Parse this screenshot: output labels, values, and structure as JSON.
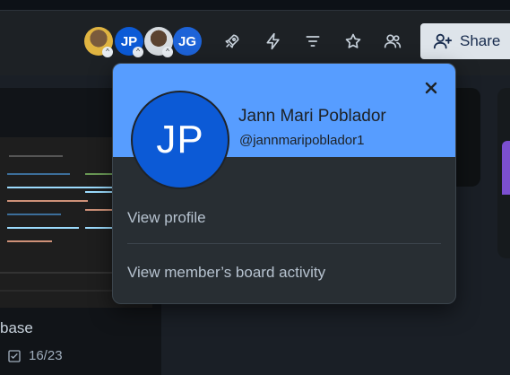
{
  "header": {
    "members": [
      {
        "initials": "",
        "type": "photo"
      },
      {
        "initials": "JP",
        "type": "initials"
      },
      {
        "initials": "",
        "type": "photo"
      },
      {
        "initials": "JG",
        "type": "initials"
      }
    ],
    "icons": [
      "rocket-icon",
      "lightning-icon",
      "filter-icon",
      "star-icon",
      "people-icon"
    ],
    "share_label": "Share"
  },
  "card": {
    "title": "base",
    "checklist": "16/23"
  },
  "popover": {
    "initials": "JP",
    "full_name": "Jann Mari Poblador",
    "username": "@jannmaripoblador1",
    "menu": [
      "View profile",
      "View member’s board activity"
    ]
  },
  "colors": {
    "accent": "#579dff",
    "avatar": "#0c5ad6",
    "popover_bg": "#282e33"
  }
}
